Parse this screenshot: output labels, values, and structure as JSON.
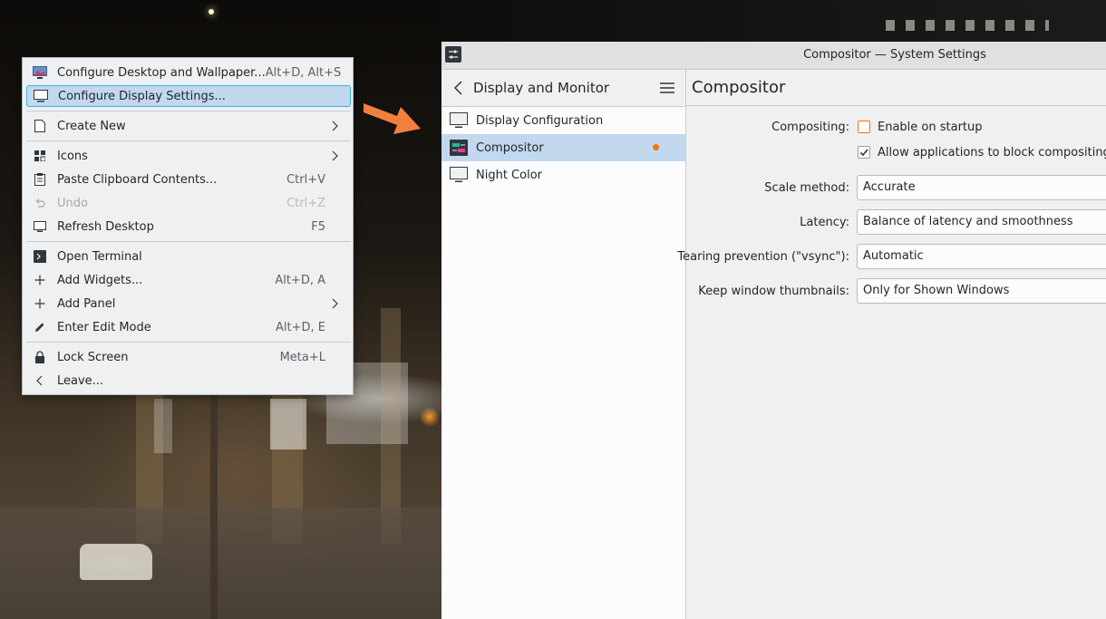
{
  "context_menu": {
    "items": [
      {
        "label": "Configure Desktop and Wallpaper...",
        "shortcut": "Alt+D, Alt+S",
        "icon": "wallpaper-icon"
      },
      {
        "label": "Configure Display Settings...",
        "shortcut": "",
        "icon": "monitor-icon"
      },
      {
        "label": "Create New",
        "shortcut": "",
        "icon": "document-new-icon"
      },
      {
        "label": "Icons",
        "shortcut": "",
        "icon": "grid-icon"
      },
      {
        "label": "Paste Clipboard Contents...",
        "shortcut": "Ctrl+V",
        "icon": "clipboard-icon"
      },
      {
        "label": "Undo",
        "shortcut": "Ctrl+Z",
        "icon": "undo-icon"
      },
      {
        "label": "Refresh Desktop",
        "shortcut": "F5",
        "icon": "refresh-icon"
      },
      {
        "label": "Open Terminal",
        "shortcut": "",
        "icon": "terminal-icon"
      },
      {
        "label": "Add Widgets...",
        "shortcut": "Alt+D, A",
        "icon": "plus-icon"
      },
      {
        "label": "Add Panel",
        "shortcut": "",
        "icon": "plus-icon"
      },
      {
        "label": "Enter Edit Mode",
        "shortcut": "Alt+D, E",
        "icon": "pencil-icon"
      },
      {
        "label": "Lock Screen",
        "shortcut": "Meta+L",
        "icon": "lock-icon"
      },
      {
        "label": "Leave...",
        "shortcut": "",
        "icon": "chevron-left-icon"
      }
    ]
  },
  "window": {
    "title": "Compositor — System Settings"
  },
  "sidebar": {
    "title": "Display and Monitor",
    "items": [
      {
        "label": "Display Configuration",
        "icon": "monitor-icon"
      },
      {
        "label": "Compositor",
        "icon": "compositor-icon"
      },
      {
        "label": "Night Color",
        "icon": "monitor-icon"
      }
    ]
  },
  "page": {
    "title": "Compositor",
    "compositing_label": "Compositing:",
    "enable_on_startup": {
      "label": "Enable on startup",
      "checked": false
    },
    "allow_block": {
      "label": "Allow applications to block compositing",
      "checked": true
    },
    "scale_method": {
      "label": "Scale method:",
      "value": "Accurate"
    },
    "latency": {
      "label": "Latency:",
      "value": "Balance of latency and smoothness"
    },
    "tearing": {
      "label": "Tearing prevention (\"vsync\"):",
      "value": "Automatic"
    },
    "thumbnails": {
      "label": "Keep window thumbnails:",
      "value": "Only for Shown Windows"
    }
  },
  "colors": {
    "accent": "#3daee9",
    "highlight": "#c2d8ef",
    "annotation_arrow": "#f0803c",
    "modified_dot": "#f67400"
  }
}
